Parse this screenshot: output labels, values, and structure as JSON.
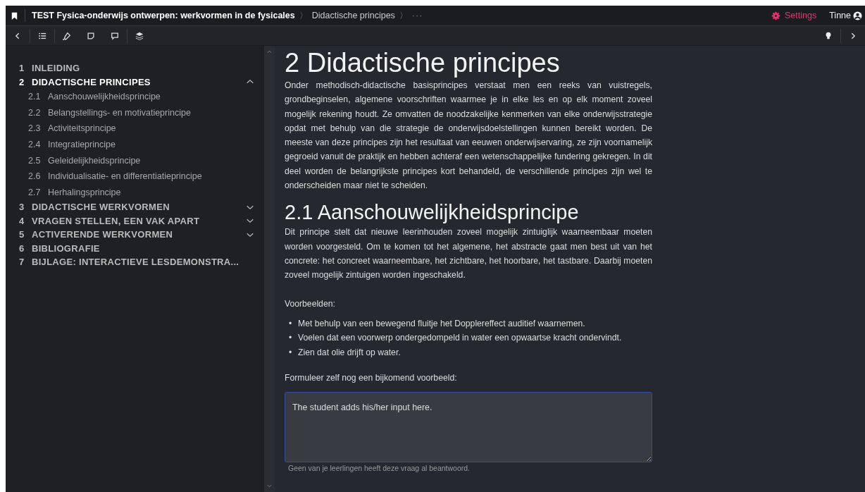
{
  "header": {
    "book_title": "TEST Fysica-onderwijs ontwerpen: werkvormen in de fysicales",
    "separators": [
      "〉",
      "〉"
    ],
    "breadcrumb": "Didactische principes",
    "more": "···",
    "settings": "Settings",
    "user": "Tinne"
  },
  "sidebar": {
    "items": [
      {
        "number": "1",
        "title": "INLEIDING",
        "selected": false
      },
      {
        "number": "2",
        "title": "DIDACTISCHE PRINCIPES",
        "selected": true,
        "expanded": true,
        "children": [
          {
            "number": "2.1",
            "title": "Aanschouwelijkheidsprincipe"
          },
          {
            "number": "2.2",
            "title": "Belangstellings- en motivatieprincipe"
          },
          {
            "number": "2.3",
            "title": "Activiteitsprincipe"
          },
          {
            "number": "2.4",
            "title": "Integratieprincipe"
          },
          {
            "number": "2.5",
            "title": "Geleidelijkheidsprincipe"
          },
          {
            "number": "2.6",
            "title": "Individualisatie- en differentiatieprincipe"
          },
          {
            "number": "2.7",
            "title": "Herhalingsprincipe"
          }
        ]
      },
      {
        "number": "3",
        "title": "DIDACTISCHE WERKVORMEN",
        "selected": false,
        "expanded": false
      },
      {
        "number": "4",
        "title": "VRAGEN STELLEN, EEN VAK APART",
        "selected": false,
        "expanded": false
      },
      {
        "number": "5",
        "title": "ACTIVERENDE WERKVORMEN",
        "selected": false,
        "expanded": false
      },
      {
        "number": "6",
        "title": "BIBLIOGRAFIE",
        "selected": false
      },
      {
        "number": "7",
        "title": "BIJLAGE: INTERACTIEVE LESDEMONSTRA...",
        "selected": false
      }
    ]
  },
  "content": {
    "heading": "2 Didactische principes",
    "intro": "Onder methodisch-didactische basisprincipes verstaat men een reeks van vuistregels, grondbeginselen, algemene voorschriften waarmee je in elke les en op elk moment zoveel mogelijk rekening houdt. Ze omvatten de noodzakelijke kenmerken van elke onderwijsstrategie opdat met behulp van die strategie de onderwijsdoelstellingen kunnen bereikt worden. De meeste van deze principes zijn het resultaat van eeuwen onderwijservaring, ze zijn voornamelijk gegroeid vanuit de praktijk en hebben achteraf een wetenschappelijke fundering gekregen. In dit deel worden de belangrijkste principes kort behandeld, de verschillende principes zijn wel te onderscheiden maar niet te scheiden.",
    "subheading": "2.1 Aanschouwelijkheidsprincipe",
    "paragraph": "Dit principe stelt dat nieuwe leerinhouden zoveel mogelijk zintuiglijk waarneembaar moeten worden voorgesteld. Om te komen tot het algemene, het abstracte gaat men best uit van het concrete: het concreet waarneembare, het zichtbare, het hoorbare, het tastbare. Daarbij moeten zoveel mogelijk zintuigen worden ingeschakeld.",
    "examples_label": "Voorbeelden:",
    "bullet": "•",
    "examples": [
      "Met behulp van een bewegend fluitje het Dopplereffect auditief waarnemen.",
      "Voelen dat een voorwerp ondergedompeld in water een opwaartse kracht ondervindt.",
      "Zien dat olie drijft op water."
    ],
    "question": "Formuleer zelf nog een bijkomend voorbeeld:",
    "answer": "The student adds his/her input here.",
    "note": "Geen van je leerlingen heeft deze vraag al beantwoord."
  }
}
